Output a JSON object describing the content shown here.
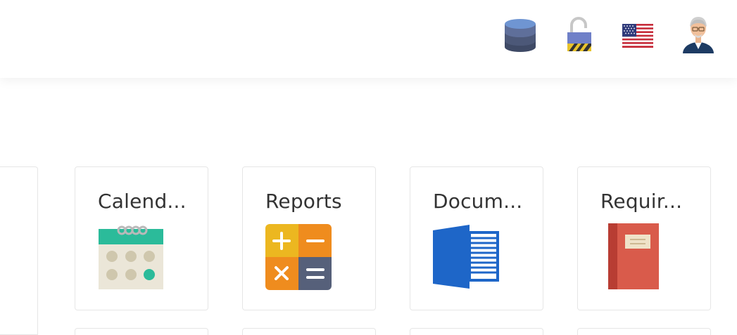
{
  "header": {
    "icons": [
      {
        "name": "database-icon"
      },
      {
        "name": "unlocked-padlock-icon"
      },
      {
        "name": "us-flag-icon"
      },
      {
        "name": "user-avatar"
      }
    ]
  },
  "tiles": [
    {
      "label": "Calend...",
      "icon": "calendar-icon"
    },
    {
      "label": "Reports",
      "icon": "calculator-icon"
    },
    {
      "label": "Docum...",
      "icon": "word-document-icon"
    },
    {
      "label": "Requir...",
      "icon": "book-icon"
    }
  ],
  "colors": {
    "calendar_header": "#2bbb9a",
    "calendar_body": "#ebe6d8",
    "calc_yellow": "#ecb720",
    "calc_orange": "#ef8c1e",
    "calc_slate": "#56607a",
    "word_blue": "#1e66c8",
    "book_red": "#d95b4b"
  }
}
